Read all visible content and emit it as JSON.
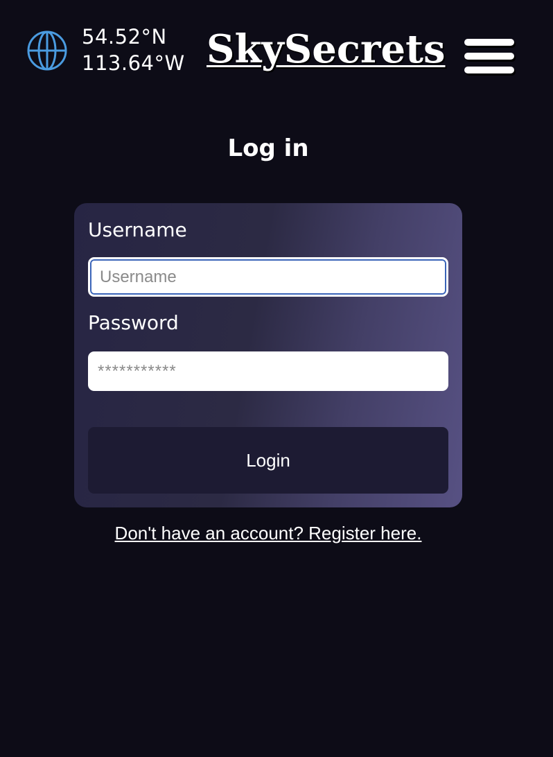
{
  "header": {
    "globe_icon": "globe-icon",
    "latitude": "54.52°N",
    "longitude": "113.64°W",
    "brand": "SkySecrets",
    "menu_icon": "hamburger-menu-icon"
  },
  "page_title": "Log in",
  "form": {
    "username_label": "Username",
    "username_placeholder": "Username",
    "username_value": "",
    "password_label": "Password",
    "password_placeholder": "***********",
    "password_value": "",
    "submit_label": "Login"
  },
  "register_link": "Don't have an account? Register here.",
  "colors": {
    "background": "#0d0c17",
    "globe_accent": "#4a9be0",
    "focus_ring": "#3a64b8",
    "button_bg": "#1d1b33"
  }
}
